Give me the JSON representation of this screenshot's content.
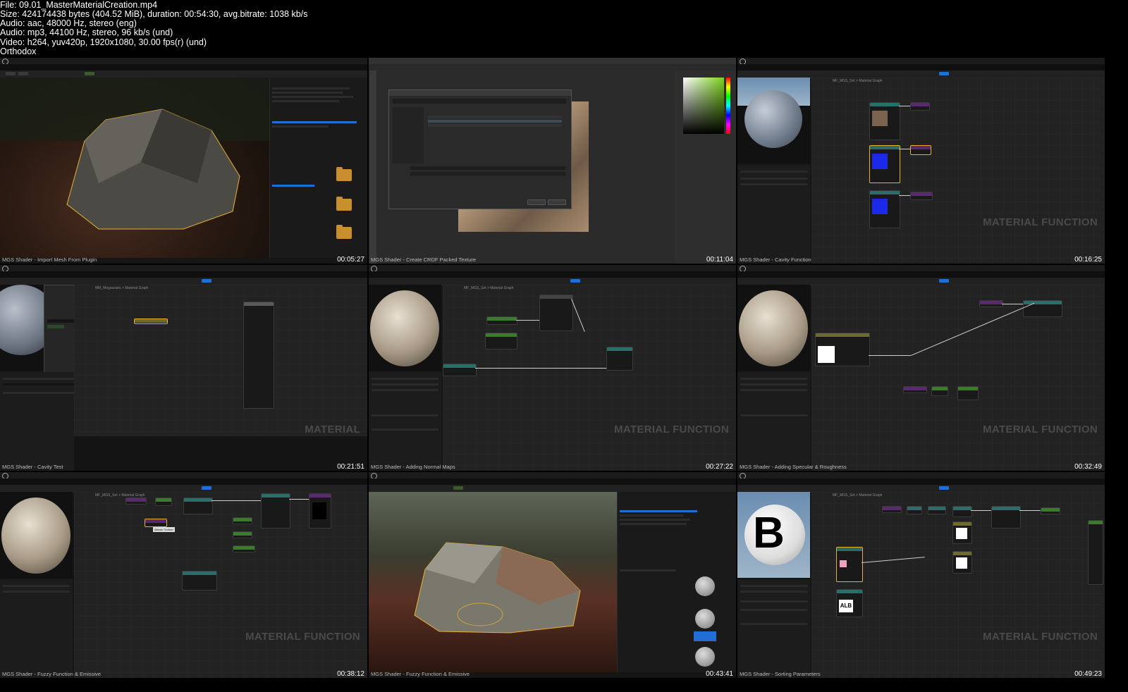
{
  "file_info": {
    "lines": [
      "File: 09.01_MasterMaterialCreation.mp4",
      "Size: 424174438 bytes (404.52 MiB), duration: 00:54:30, avg.bitrate: 1038 kb/s",
      "Audio: aac, 48000 Hz, stereo (eng)",
      "Audio: mp3, 44100 Hz, stereo, 96 kb/s (und)",
      "Video: h264, yuv420p, 1920x1080, 30.00 fps(r) (und)",
      "Orthodox"
    ]
  },
  "thumbnails": [
    {
      "caption": "MGS Shader - Import Mesh From Plugin",
      "timestamp": "00:05:27",
      "watermark": "",
      "breadcrumb": "",
      "kind": "viewport"
    },
    {
      "caption": "MGS Shader - Create CRDF Packed Texture",
      "timestamp": "00:11:04",
      "watermark": "",
      "breadcrumb": "",
      "kind": "photoshop"
    },
    {
      "caption": "MGS Shader - Cavity Function",
      "timestamp": "00:16:25",
      "watermark": "MATERIAL FUNCTION",
      "breadcrumb": "MF_MGS_Set > Material Graph",
      "kind": "graph"
    },
    {
      "caption": "MGS Shader - Cavity Test",
      "timestamp": "00:21:51",
      "watermark": "MATERIAL",
      "breadcrumb": "MM_Megascans > Material Graph",
      "kind": "graph"
    },
    {
      "caption": "MGS Shader - Adding Normal Maps",
      "timestamp": "00:27:22",
      "watermark": "MATERIAL FUNCTION",
      "breadcrumb": "MF_MGS_Set > Material Graph",
      "kind": "graph"
    },
    {
      "caption": "MGS Shader - Adding Specular & Roughness",
      "timestamp": "00:32:49",
      "watermark": "MATERIAL FUNCTION",
      "breadcrumb": "MF_MGS_Set > Material Graph",
      "kind": "graph"
    },
    {
      "caption": "MGS Shader - Fuzzy Function & Emissive",
      "timestamp": "00:38:12",
      "watermark": "MATERIAL FUNCTION",
      "breadcrumb": "MF_MGS_Set > Material Graph",
      "kind": "graph"
    },
    {
      "caption": "MGS Shader - Fuzzy Function & Emissive",
      "timestamp": "00:43:41",
      "watermark": "",
      "breadcrumb": "",
      "kind": "viewport"
    },
    {
      "caption": "MGS Shader - Sorting Parameters",
      "timestamp": "00:49:23",
      "watermark": "MATERIAL FUNCTION",
      "breadcrumb": "MF_MGS_Set > Material Graph",
      "kind": "graph"
    }
  ],
  "labels": {
    "tooltip": "Albedo Texture",
    "alb_text": "ALB",
    "b_text": "B"
  },
  "colors": {
    "accent": "#1f6fd6",
    "node_teal": "#2a6e6a",
    "node_green": "#3c7a2e",
    "node_purple": "#5a2a6e",
    "node_olive": "#6e6a2a",
    "folder": "#c98e2e"
  }
}
